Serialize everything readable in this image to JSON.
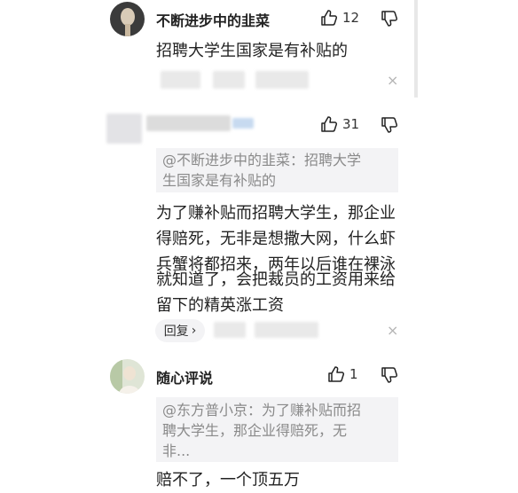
{
  "comments": [
    {
      "username": "不断进步中的韭菜",
      "likes": "12",
      "lines": [
        "招聘大学生国家是有补贴的"
      ]
    },
    {
      "username": "",
      "likes": "31",
      "quote_lines": [
        "@不断进步中的韭菜：招聘大学",
        "生国家是有补贴的"
      ],
      "lines": [
        "为了赚补贴而招聘大学生，那企业",
        "得赔死，无非是想撒大网，什么虾",
        "兵蟹将都招来，两年以后谁在裸泳",
        "就知道了，会把裁员的工资用来给",
        "留下的精英涨工资"
      ],
      "reply_label": "回复",
      "reply_chevron": "›"
    },
    {
      "username": "随心评说",
      "likes": "1",
      "quote_lines": [
        "@东方普小京：为了赚补贴而招",
        "聘大学生，那企业得赔死，无",
        "非..."
      ],
      "lines": [
        "赔不了，一个顶五万"
      ]
    }
  ],
  "icons": {
    "like": "thumbs-up-icon",
    "dislike": "thumbs-down-icon",
    "close": "close-icon"
  },
  "close_symbol": "×"
}
